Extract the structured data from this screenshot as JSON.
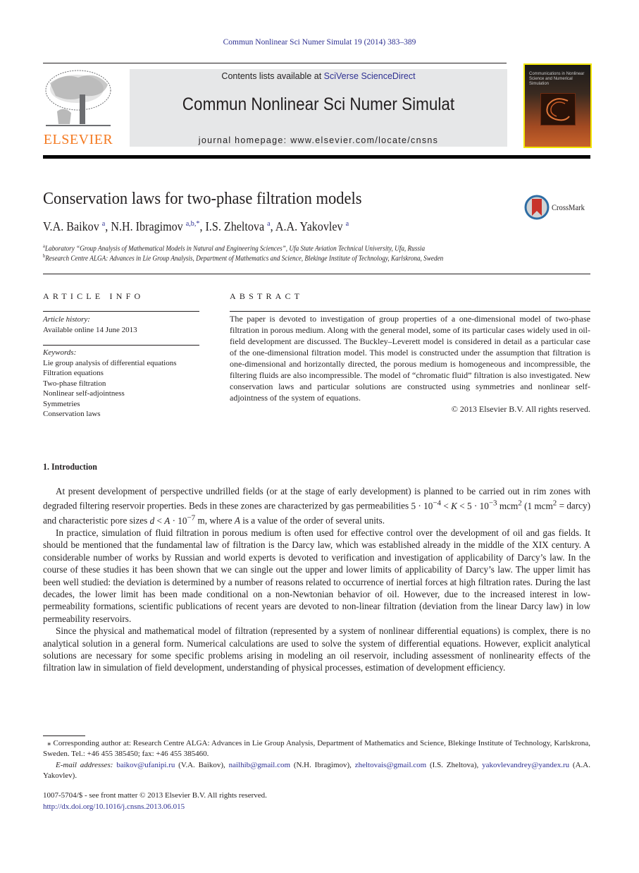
{
  "running_head": "Commun Nonlinear Sci Numer Simulat 19 (2014) 383–389",
  "header": {
    "publisher_logo": "ELSEVIER",
    "contents_prefix": "Contents lists available at ",
    "contents_link": "SciVerse ScienceDirect",
    "journal_name": "Commun Nonlinear Sci Numer Simulat",
    "homepage": "journal homepage: www.elsevier.com/locate/cnsns",
    "cover_title": "Communications in Nonlinear Science and Numerical Simulation",
    "colors": {
      "logo_orange": "#f47920",
      "link_blue": "#2e3092",
      "banner_gray": "#e6e7e8",
      "cover_border": "#f2e600"
    }
  },
  "article": {
    "title": "Conservation laws for two-phase filtration models",
    "crossmark_label": "CrossMark",
    "authors": [
      {
        "name": "V.A. Baikov",
        "sup": "a",
        "sep": ", "
      },
      {
        "name": "N.H. Ibragimov",
        "sup": "a,b,*",
        "sep": ", "
      },
      {
        "name": "I.S. Zheltova",
        "sup": "a",
        "sep": ", "
      },
      {
        "name": "A.A. Yakovlev",
        "sup": "a",
        "sep": ""
      }
    ],
    "affiliations": [
      {
        "mark": "a",
        "text": "Laboratory “Group Analysis of Mathematical Models in Natural and Engineering Sciences”, Ufa State Aviation Technical University, Ufa, Russia"
      },
      {
        "mark": "b",
        "text": "Research Centre ALGA: Advances in Lie Group Analysis, Department of Mathematics and Science, Blekinge Institute of Technology, Karlskrona, Sweden"
      }
    ]
  },
  "article_info": {
    "heading": "ARTICLE INFO",
    "history_label": "Article history:",
    "history_value": "Available online 14 June 2013",
    "keywords_label": "Keywords:",
    "keywords": [
      "Lie group analysis of differential equations",
      "Filtration equations",
      "Two-phase filtration",
      "Nonlinear self-adjointness",
      "Symmetries",
      "Conservation laws"
    ]
  },
  "abstract": {
    "heading": "ABSTRACT",
    "text": "The paper is devoted to investigation of group properties of a one-dimensional model of two-phase filtration in porous medium. Along with the general model, some of its partic­ular cases widely used in oil-field development are discussed. The Buckley–Leverett model is considered in detail as a particular case of the one-dimensional filtration model. This model is constructed under the assumption that filtration is one-dimensional and horizontally directed, the porous medium is homogeneous and incompressible, the filtering fluids are also incompressible. The model of “chromatic fluid” filtration is also investigated. New conservation laws and particular solutions are constructed using symmetries and nonlinear self-adjointness of the system of equations.",
    "copyright": "© 2013 Elsevier B.V. All rights reserved."
  },
  "introduction": {
    "heading": "1. Introduction",
    "p1_a": "At present development of perspective undrilled fields (or at the stage of early development) is planned to be carried out in rim zones with degraded filtering reservoir properties. Beds in these zones are characterized by gas permeabilities ",
    "p1_math1": "5 · 10",
    "p1_exp1": "−4",
    "p1_lt1": " < ",
    "p1_K": "K",
    "p1_lt2": " < 5 · 10",
    "p1_exp2": "−3",
    "p1_unit": " mcm",
    "p1_exp3": "2",
    "p1_paren": " (1 mcm",
    "p1_exp4": "2",
    "p1_b": " = darcy) and characteristic pore sizes ",
    "p1_d": "d",
    "p1_lt3": " < ",
    "p1_A": "A",
    "p1_math2": " · 10",
    "p1_exp5": "−7",
    "p1_c": " m, where ",
    "p1_A2": "A",
    "p1_d_end": " is a value of the order of several units.",
    "p2": "In practice, simulation of fluid filtration in porous medium is often used for effective control over the development of oil and gas fields. It should be mentioned that the fundamental law of filtration is the Darcy law, which was established already in the middle of the XIX century. A considerable number of works by Russian and world experts is devoted to verification and investigation of applicability of Darcy’s law. In the course of these studies it has been shown that we can single out the upper and lower limits of applicability of Darcy’s law. The upper limit has been well studied: the deviation is determined by a num­ber of reasons related to occurrence of inertial forces at high filtration rates. During the last decades, the lower limit has been made conditional on a non-Newtonian behavior of oil. However, due to the increased interest in low-permeability forma­tions, scientific publications of recent years are devoted to non-linear filtration (deviation from the linear Darcy law) in low permeability reservoirs.",
    "p3": "Since the physical and mathematical model of filtration (represented by a system of nonlinear differential equations) is complex, there is no analytical solution in a general form. Numerical calculations are used to solve the system of differential equations. However, explicit analytical solutions are necessary for some specific problems arising in modeling an oil reser­voir, including assessment of nonlinearity effects of the filtration law in simulation of field development, understanding of physical processes, estimation of development efficiency."
  },
  "footnotes": {
    "corresponding": "⁎ Corresponding author at: Research Centre ALGA: Advances in Lie Group Analysis, Department of Mathematics and Science, Blekinge Institute of Technology, Karlskrona, Sweden. Tel.: +46 455 385450; fax: +46 455 385460.",
    "email_label": "E-mail addresses:",
    "emails": [
      {
        "address": "baikov@ufanipi.ru",
        "owner": " (V.A. Baikov), "
      },
      {
        "address": "nailhib@gmail.com",
        "owner": " (N.H. Ibragimov), "
      },
      {
        "address": "zheltovais@gmail.com",
        "owner": " (I.S. Zheltova), "
      },
      {
        "address": "yakovlevandrey@yandex.ru",
        "owner": " (A.A. Yakovlev)."
      }
    ]
  },
  "front_matter": {
    "issn_line": "1007-5704/$ - see front matter © 2013 Elsevier B.V. All rights reserved.",
    "doi": "http://dx.doi.org/10.1016/j.cnsns.2013.06.015"
  }
}
